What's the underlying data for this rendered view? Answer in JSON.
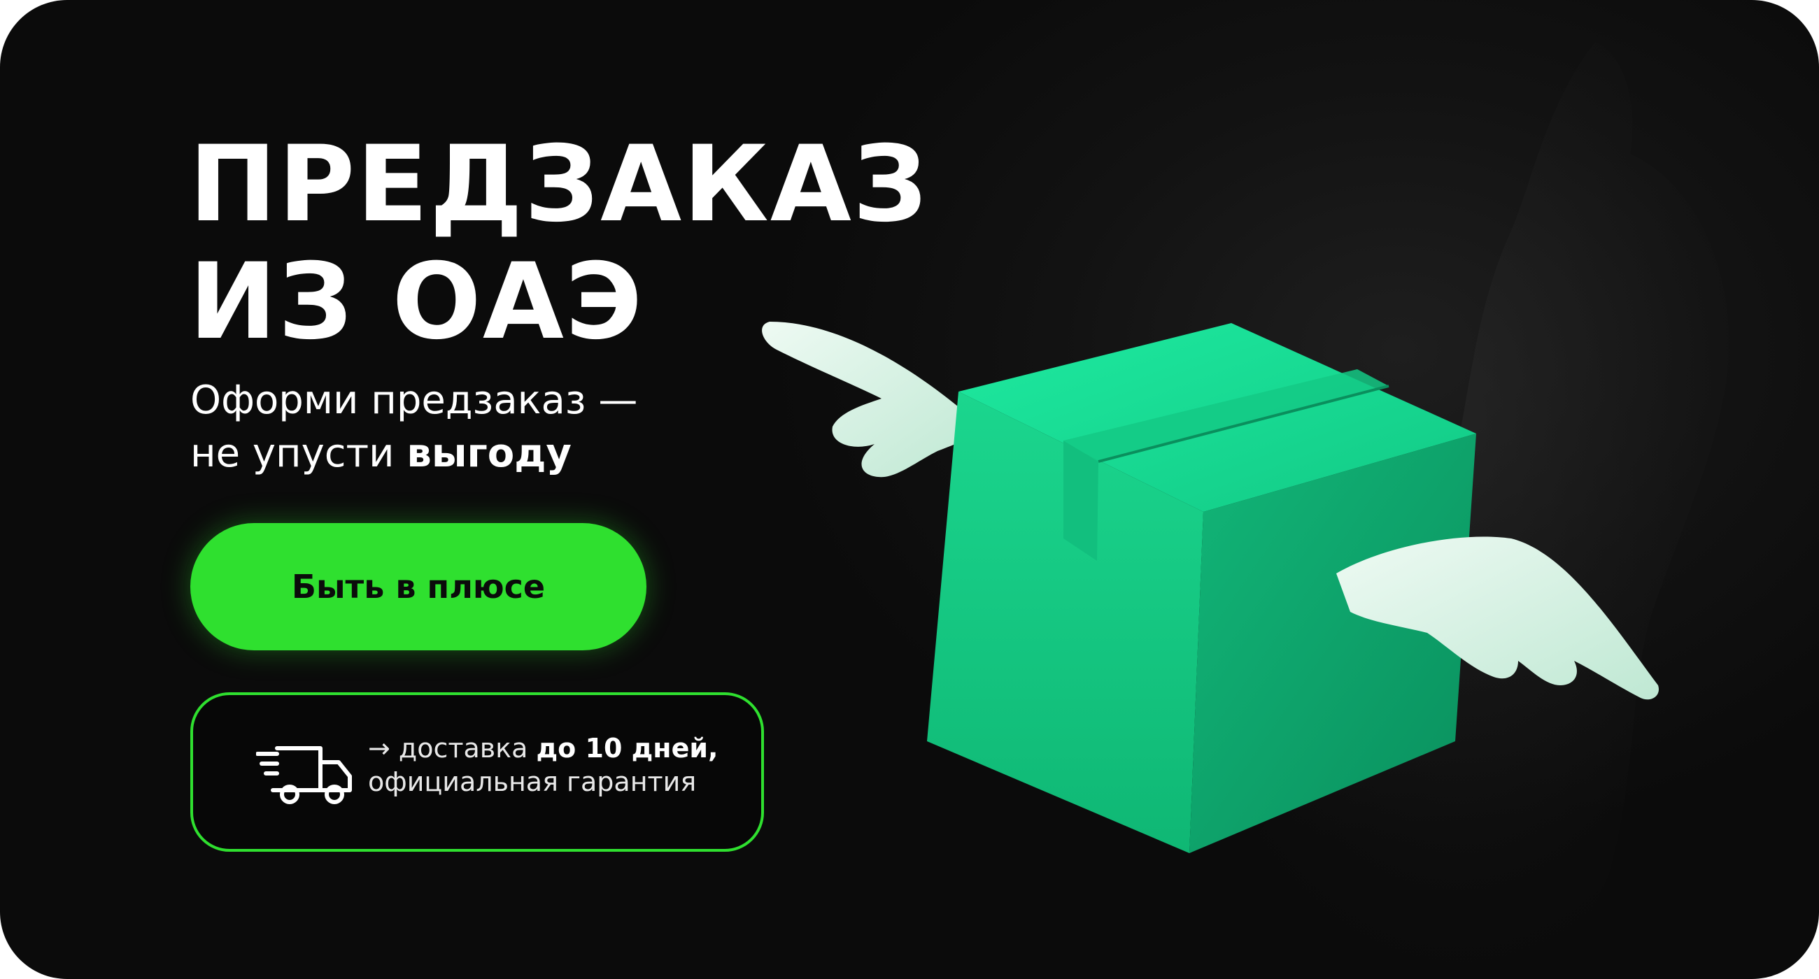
{
  "banner": {
    "title_line1": "ПРЕДЗАКАЗ",
    "title_line2": "ИЗ ОАЭ",
    "subtitle_line1": "Оформи предзаказ —",
    "subtitle_line2_prefix": "не упусти",
    "subtitle_line2_bold": "выгоду",
    "cta_label": "Быть в плюсе",
    "delivery_prefix": "→ доставка",
    "delivery_bold": "до 10 дней,",
    "delivery_line2": "официальная гарантия"
  },
  "icons": {
    "truck": "delivery-truck-icon",
    "box": "winged-box-illustration"
  },
  "colors": {
    "background": "#0b0b0b",
    "accent": "#2fe02f",
    "box_green": "#16d68a",
    "wing": "#d9f4e6",
    "text": "#ffffff"
  }
}
